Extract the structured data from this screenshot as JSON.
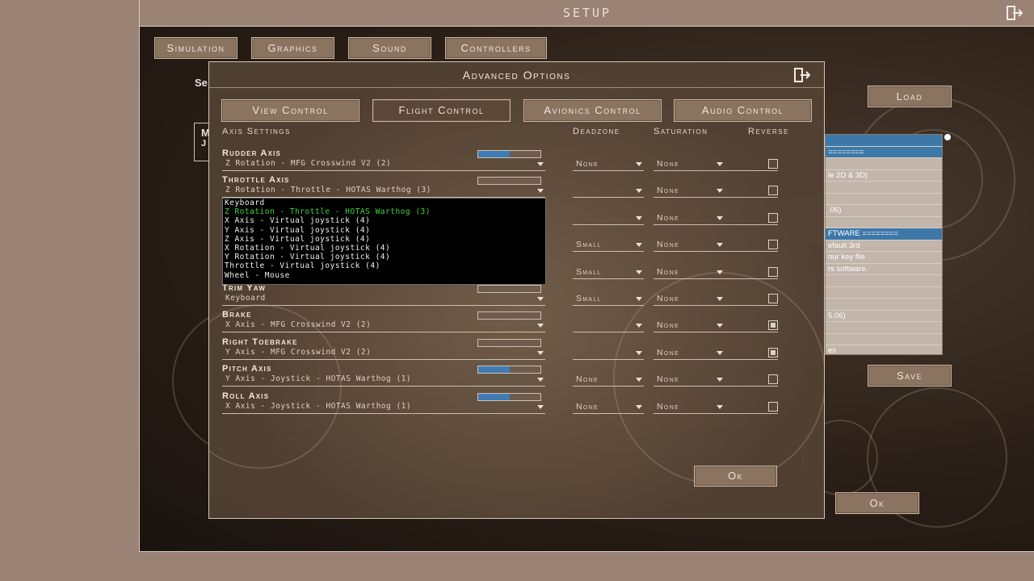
{
  "setup": {
    "title": "SETUP",
    "tabs": [
      "Simulation",
      "Graphics",
      "Sound",
      "Controllers"
    ],
    "load_label": "Load",
    "save_label": "Save",
    "ok_label": "Ok",
    "side_letters": [
      "Se",
      "M",
      "J"
    ],
    "background_list": [
      {
        "text": "",
        "selected": true
      },
      {
        "text": "========",
        "selected": true
      },
      {
        "text": "",
        "selected": false
      },
      {
        "text": "le 2D & 3D)",
        "selected": false
      },
      {
        "text": "",
        "selected": false
      },
      {
        "text": "",
        "selected": false
      },
      {
        "text": ".06)",
        "selected": false
      },
      {
        "text": "",
        "selected": false
      },
      {
        "text": "FTWARE ========",
        "selected": true
      },
      {
        "text": "efault 3rd",
        "selected": false
      },
      {
        "text": "our key file",
        "selected": false
      },
      {
        "text": "rs software.",
        "selected": false
      },
      {
        "text": "",
        "selected": false
      },
      {
        "text": "",
        "selected": false
      },
      {
        "text": "",
        "selected": false
      },
      {
        "text": "5.06)",
        "selected": false
      },
      {
        "text": "",
        "selected": false
      },
      {
        "text": "",
        "selected": false
      },
      {
        "text": "es",
        "selected": false
      }
    ]
  },
  "dialog": {
    "title": "Advanced Options",
    "tabs": [
      {
        "label": "View Control",
        "active": false
      },
      {
        "label": "Flight Control",
        "active": true
      },
      {
        "label": "Avionics Control",
        "active": false
      },
      {
        "label": "Audio Control",
        "active": false
      }
    ],
    "headers": {
      "axis_settings": "Axis Settings",
      "deadzone": "Deadzone",
      "saturation": "Saturation",
      "reverse": "Reverse"
    },
    "ok_label": "Ok",
    "axes": [
      {
        "name": "Rudder Axis",
        "binding": "Z Rotation - MFG Crosswind V2 (2)",
        "bar": 0.5,
        "deadzone": "None",
        "saturation": "None",
        "reverse": false
      },
      {
        "name": "Throttle Axis",
        "binding": "Z Rotation - Throttle - HOTAS Warthog (3)",
        "bar": 0,
        "deadzone": "",
        "saturation": "None",
        "reverse": false
      },
      {
        "name": "",
        "binding": "",
        "bar": null,
        "deadzone": "",
        "saturation": "None",
        "reverse": false
      },
      {
        "name": "",
        "binding": "",
        "bar": null,
        "deadzone": "Small",
        "saturation": "None",
        "reverse": false
      },
      {
        "name": "",
        "binding": "",
        "bar": null,
        "deadzone": "Small",
        "saturation": "None",
        "reverse": false
      },
      {
        "name": "Trim Yaw",
        "binding": "Keyboard",
        "bar": 0,
        "deadzone": "Small",
        "saturation": "None",
        "reverse": false
      },
      {
        "name": "Brake",
        "binding": "X Axis - MFG Crosswind V2 (2)",
        "bar": 0,
        "deadzone": "",
        "saturation": "None",
        "reverse": true
      },
      {
        "name": "Right Toebrake",
        "binding": "Y Axis - MFG Crosswind V2 (2)",
        "bar": 0,
        "deadzone": "",
        "saturation": "None",
        "reverse": true
      },
      {
        "name": "Pitch Axis",
        "binding": "Y Axis - Joystick - HOTAS Warthog (1)",
        "bar": 0.5,
        "deadzone": "None",
        "saturation": "None",
        "reverse": false
      },
      {
        "name": "Roll Axis",
        "binding": "X Axis - Joystick - HOTAS Warthog (1)",
        "bar": 0.5,
        "deadzone": "None",
        "saturation": "None",
        "reverse": false
      }
    ],
    "dropdown_options": [
      {
        "text": "Keyboard",
        "highlighted": false
      },
      {
        "text": "Z Rotation - Throttle - HOTAS Warthog (3)",
        "highlighted": true
      },
      {
        "text": "X Axis - Virtual joystick (4)",
        "highlighted": false
      },
      {
        "text": "Y Axis - Virtual joystick (4)",
        "highlighted": false
      },
      {
        "text": "Z Axis - Virtual joystick (4)",
        "highlighted": false
      },
      {
        "text": "X Rotation - Virtual joystick (4)",
        "highlighted": false
      },
      {
        "text": "Y Rotation - Virtual joystick (4)",
        "highlighted": false
      },
      {
        "text": "Throttle - Virtual joystick (4)",
        "highlighted": false
      },
      {
        "text": "Wheel - Mouse",
        "highlighted": false
      }
    ]
  },
  "colors": {
    "accent_bar": "#3f7cb5",
    "highlight_text": "#3cd83c",
    "list_selection": "#3d78a8"
  },
  "icons": {
    "exit": "exit-door-icon",
    "dropdown": "chevron-down-icon"
  }
}
